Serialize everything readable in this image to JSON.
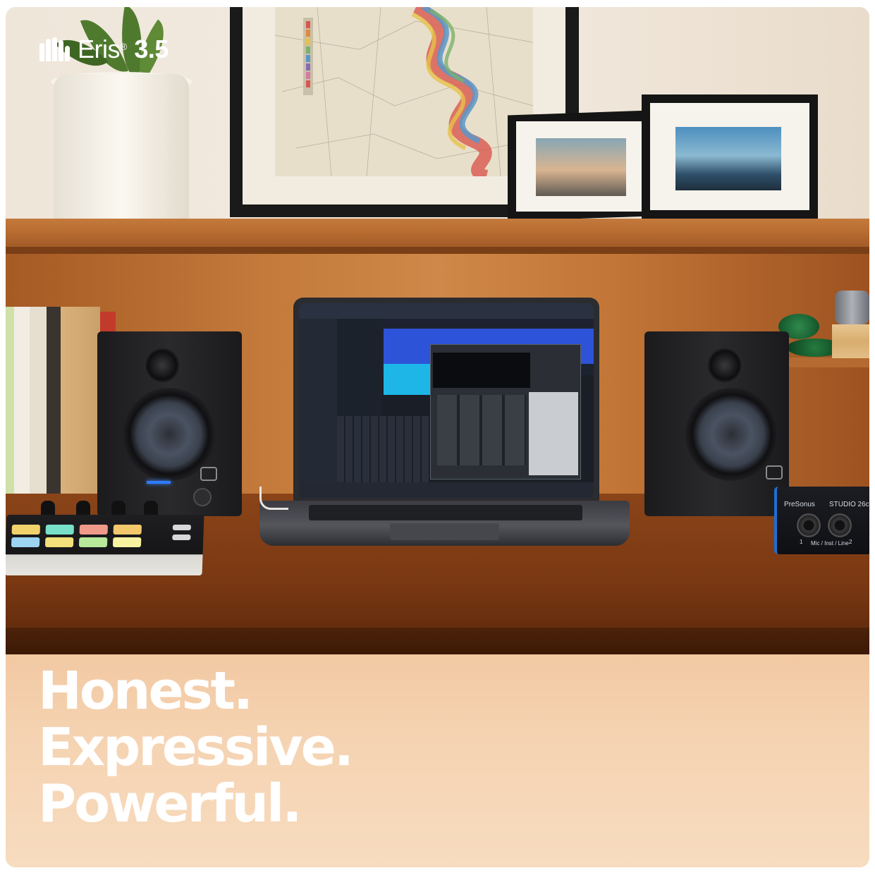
{
  "brand": {
    "logo": "presonus-logo-icon",
    "product_name": "Eris",
    "registered_mark": "®",
    "model_number": "3.5"
  },
  "tagline": {
    "line1": "Honest.",
    "line2": "Expressive.",
    "line3": "Powerful."
  },
  "interface_labels": {
    "brand": "PreSonus",
    "model": "STUDIO 26c",
    "input_label": "Mic / Inst / Line",
    "channel_1": "1",
    "channel_2": "2"
  },
  "colors": {
    "text": "#ffffff",
    "accent_blue": "#2f7bff",
    "wood": "#b86c30",
    "lower_wall": "#f5d3b2"
  }
}
